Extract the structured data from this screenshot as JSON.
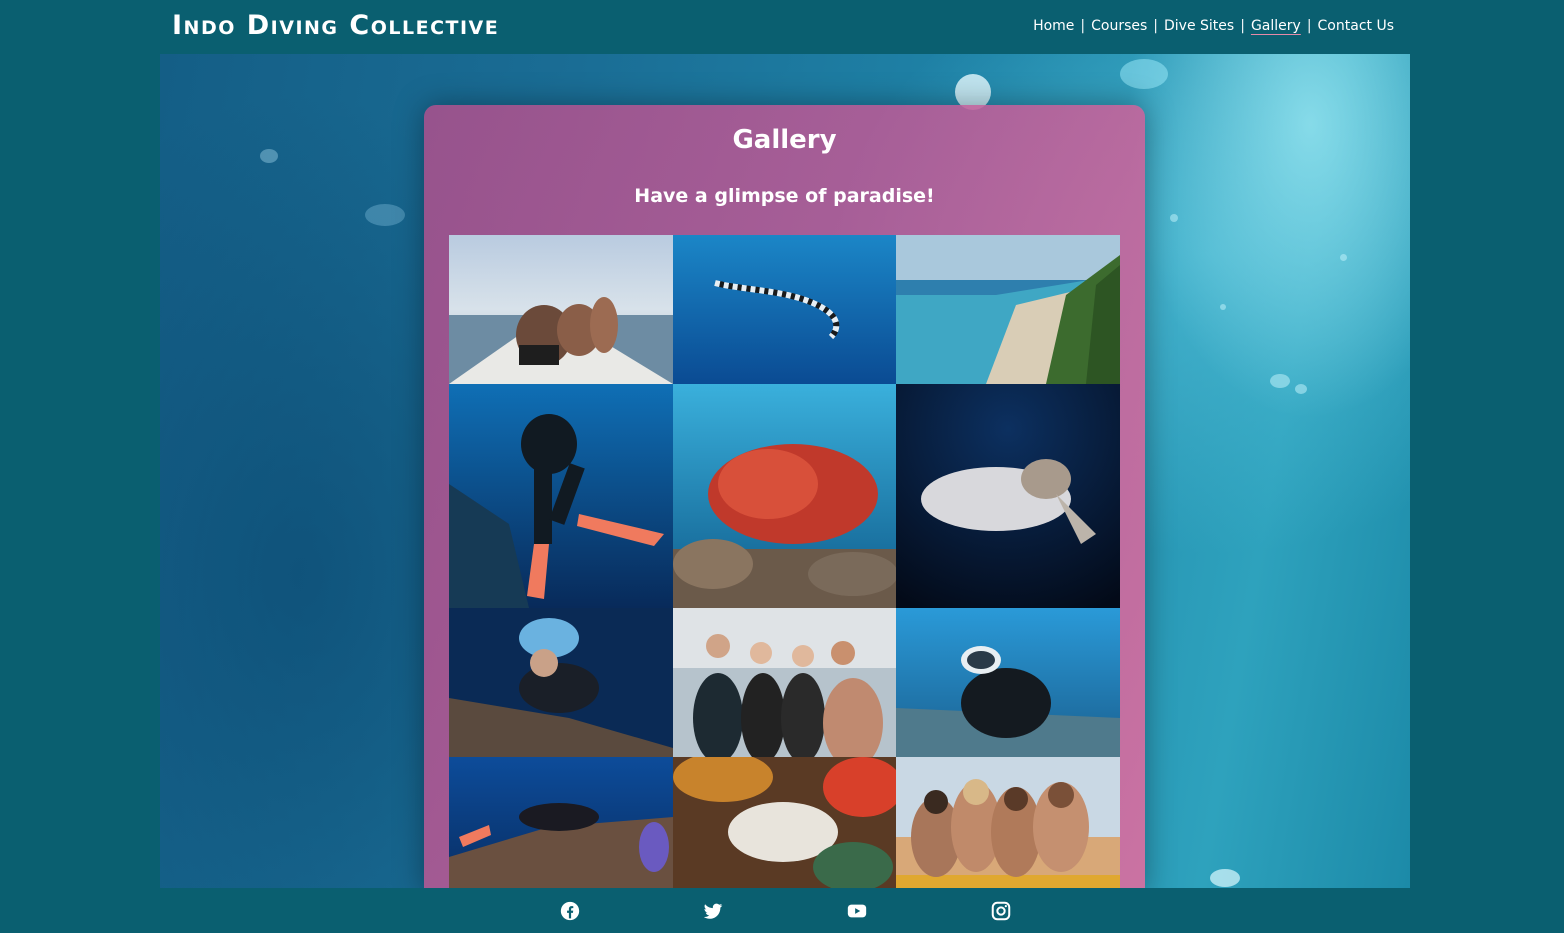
{
  "header": {
    "brand": "Indo Diving Collective",
    "nav": [
      {
        "label": "Home"
      },
      {
        "label": "Courses"
      },
      {
        "label": "Dive Sites"
      },
      {
        "label": "Gallery",
        "active": true
      },
      {
        "label": "Contact Us"
      }
    ],
    "separator": "|"
  },
  "gallery": {
    "title": "Gallery",
    "subtitle": "Have a glimpse of paradise!"
  },
  "footer": {
    "social": [
      "facebook-icon",
      "twitter-icon",
      "youtube-icon",
      "instagram-icon"
    ]
  },
  "colors": {
    "header_bg": "#0a5f70",
    "card_pink": "#c05a96",
    "accent_underline": "#e68aa8"
  }
}
